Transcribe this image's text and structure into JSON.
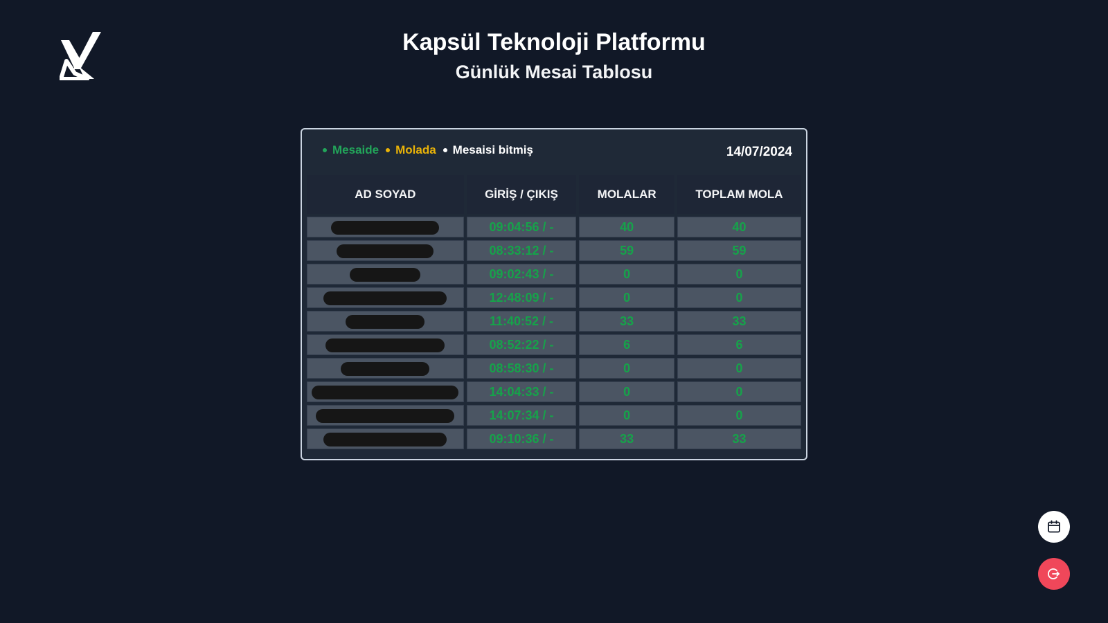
{
  "header": {
    "title": "Kapsül Teknoloji Platformu",
    "subtitle": "Günlük Mesai Tablosu"
  },
  "legend": [
    {
      "label": "Mesaide",
      "color": "#22a55a"
    },
    {
      "label": "Molada",
      "color": "#eab308"
    },
    {
      "label": "Mesaisi bitmiş",
      "color": "#ffffff"
    }
  ],
  "date": "14/07/2024",
  "table": {
    "columns": [
      "AD SOYAD",
      "GİRİŞ / ÇIKIŞ",
      "MOLALAR",
      "TOPLAM MOLA"
    ],
    "rows": [
      {
        "name": "[redacted]",
        "in_out": "09:04:56 / -",
        "breaks": "40",
        "total_break": "40"
      },
      {
        "name": "[redacted]",
        "in_out": "08:33:12 / -",
        "breaks": "59",
        "total_break": "59"
      },
      {
        "name": "[redacted]",
        "in_out": "09:02:43 / -",
        "breaks": "0",
        "total_break": "0"
      },
      {
        "name": "[redacted]",
        "in_out": "12:48:09 / -",
        "breaks": "0",
        "total_break": "0"
      },
      {
        "name": "[redacted]",
        "in_out": "11:40:52 / -",
        "breaks": "33",
        "total_break": "33"
      },
      {
        "name": "[redacted]",
        "in_out": "08:52:22 / -",
        "breaks": "6",
        "total_break": "6"
      },
      {
        "name": "[redacted]",
        "in_out": "08:58:30 / -",
        "breaks": "0",
        "total_break": "0"
      },
      {
        "name": "[redacted]",
        "in_out": "14:04:33 / -",
        "breaks": "0",
        "total_break": "0"
      },
      {
        "name": "[redacted]",
        "in_out": "14:07:34 / -",
        "breaks": "0",
        "total_break": "0"
      },
      {
        "name": "[redacted]",
        "in_out": "09:10:36 / -",
        "breaks": "33",
        "total_break": "33"
      }
    ]
  },
  "colors": {
    "background": "#111827",
    "status_green": "#16a34a",
    "status_yellow": "#eab308",
    "logout": "#f0475a"
  },
  "icons": {
    "logo": "brand-logo-icon",
    "calendar": "calendar-icon",
    "logout": "logout-icon"
  }
}
